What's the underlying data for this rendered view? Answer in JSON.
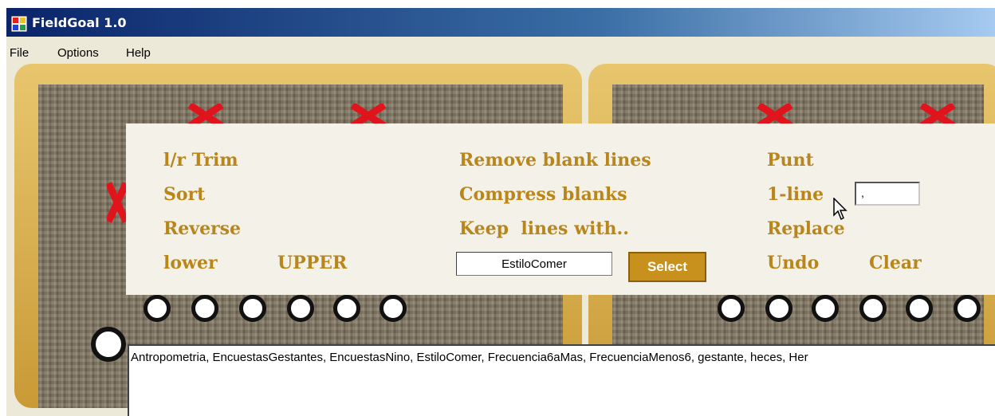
{
  "window": {
    "title": "FieldGoal 1.0"
  },
  "menu": {
    "items": [
      "File",
      "Options",
      "Help"
    ]
  },
  "commands": {
    "lr_trim": "l/r Trim",
    "sort": "Sort",
    "reverse": "Reverse",
    "lower": "lower",
    "upper": "UPPER",
    "remove_blank_lines": "Remove blank lines",
    "compress_blanks": "Compress blanks",
    "keep_lines_with": "Keep  lines with..",
    "punt": "Punt",
    "one_line": "1-line",
    "replace": "Replace",
    "undo": "Undo",
    "clear": "Clear"
  },
  "filter": {
    "value": "EstiloComer",
    "select_label": "Select"
  },
  "delimiter": {
    "value": ","
  },
  "output": {
    "text": "Antropometria, EncuestasGestantes, EncuestasNino, EstiloComer, Frecuencia6aMas, FrecuenciaMenos6, gestante, heces, Her"
  },
  "colors": {
    "command_text": "#b8861b",
    "button": "#c8901d",
    "board_frame": "#d4a84a"
  },
  "icons": {
    "app": "app-icon",
    "cursor": "cursor-icon",
    "x_marker": "x-mark-icon"
  }
}
